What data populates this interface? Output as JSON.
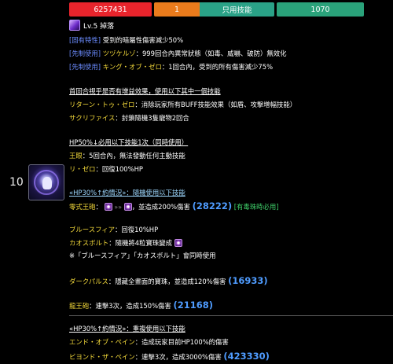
{
  "stats": {
    "hp": "6257431",
    "cooldown": "1",
    "skill_type": "只用技能",
    "atk": "1070"
  },
  "row_number": "10",
  "skill": {
    "level": "Lv.5 掉落"
  },
  "lines": {
    "l1_label": "[固有特性]",
    "l1_text": " 受到的暗屬性傷害減少50%",
    "l2_label": "[先制使用]",
    "l2_name": " ツヅケルゾ",
    "l2_text": "：999回合內異常狀態（如毒、威嚇、破防）無效化",
    "l3_label": "[先制使用]",
    "l3_name": " キング・オブ・ゼロ",
    "l3_text": "：1回合內，受到的所有傷害減少75%",
    "first_turn_head": "首回合視乎是否有增益效果，使用以下其中一個技能",
    "return_name": "リターン・トゥ・ゼロ",
    "return_text": "：消除玩家所有BUFF技能效果（如盾、攻擊增幅技能）",
    "sacrifice_name": "サクリファイス",
    "sacrifice_text": "：封鎖隨機3隻寵物2回合",
    "hp50_head": "HP50%↓必用以下技能1次（同時使用）",
    "king_label": "王眼",
    "king_text": "：5回合內，無法發動任何主動技能",
    "rizero_label": "リ・ゼロ",
    "rizero_text": "：回復100%HP",
    "hp30_head": "«HP30%↑約情況»：隨機使用以下技能",
    "zero_king_name": "零式王砲",
    "zero_king_colon": "：",
    "zero_king_arrow": "»»",
    "zero_king_text": "，並造成200%傷害",
    "zero_king_dmg": "(28222)",
    "zero_king_tag": "[有毒珠時必用]",
    "bluesphere_name": "ブルースフィア",
    "bluesphere_text": "：回復10%HP",
    "chaos_name": "カオスボルト",
    "chaos_text": "：隨機將4粒寶珠變成",
    "note": "※「ブルースフィア」「カオスボルト」會同時使用",
    "dark_name": "ダークパルス",
    "dark_text": "：隱藏全畫面的寶珠，並造成120%傷害",
    "dark_dmg": "(16933)",
    "dragon_name": "龍王砲",
    "dragon_text": "：連擊3次，造成150%傷害",
    "dragon_dmg": "(21168)",
    "hp30_2_head": "«HP30%↑約情況»：重複使用以下技能",
    "endofpain_name": "エンド・オブ・ペイン",
    "endofpain_text": "：造成玩家目前HP100%的傷害",
    "beyond_name": "ビヨンド・ザ・ペイン",
    "beyond_text": "：連擊3次，造成3000%傷害",
    "beyond_dmg": "(423330)"
  },
  "colors": {
    "hp": "#e8242c",
    "cooldown": "#ea7b1c",
    "skill": "#2aa287",
    "atk": "#2aa27a"
  }
}
